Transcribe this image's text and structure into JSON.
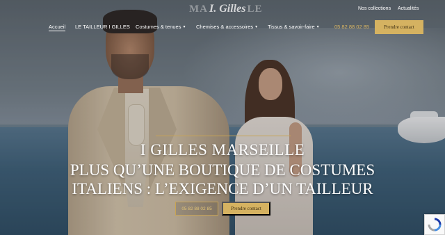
{
  "header": {
    "logo_left": "MA",
    "logo_script": "I. Gilles",
    "logo_right": "LE",
    "util_links": [
      "Nos collections",
      "Actualités"
    ],
    "nav": [
      {
        "label": "Accueil",
        "has_caret": false
      },
      {
        "label": "LE TAILLEUR I GILLES",
        "has_caret": false
      },
      {
        "label": "Costumes & tenues",
        "has_caret": true
      },
      {
        "label": "Chemises & accessoires",
        "has_caret": true
      },
      {
        "label": "Tissus & savoir-faire",
        "has_caret": true
      }
    ],
    "phone": "05 82 88 02 85",
    "contact_button": "Prendre contact"
  },
  "hero": {
    "title": "I GILLES MARSEILLE",
    "subtitle_line1": "PLUS QU’UNE BOUTIQUE DE COSTUMES",
    "subtitle_line2": "ITALIENS : L’EXIGENCE D’UN TAILLEUR",
    "phone_button": "05 82 88 02 85",
    "contact_button": "Prendre contact"
  },
  "colors": {
    "accent_gold": "#d5b261",
    "text_white": "#ffffff"
  },
  "icons": {
    "caret": "chevron-down-icon",
    "recaptcha": "recaptcha-icon"
  }
}
